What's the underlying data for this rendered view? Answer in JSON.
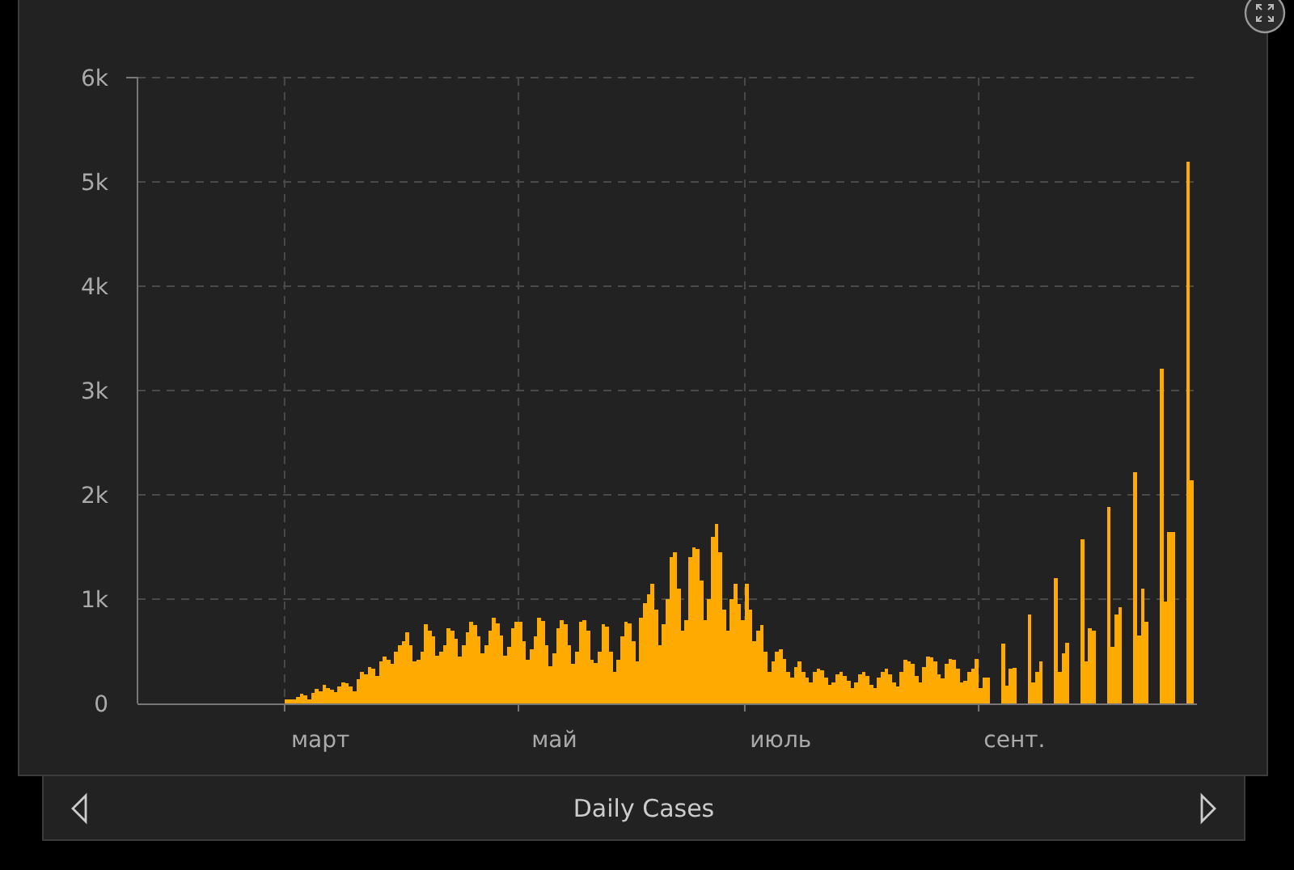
{
  "chart_data": {
    "type": "bar",
    "title": "Daily Cases",
    "ylim": [
      0,
      6000
    ],
    "yticks": [
      {
        "value": 0,
        "label": "0"
      },
      {
        "value": 1000,
        "label": "1k"
      },
      {
        "value": 2000,
        "label": "2k"
      },
      {
        "value": 3000,
        "label": "3k"
      },
      {
        "value": 4000,
        "label": "4k"
      },
      {
        "value": 5000,
        "label": "5k"
      },
      {
        "value": 6000,
        "label": "6k"
      }
    ],
    "grid": true,
    "categories": [
      null,
      null,
      null,
      null,
      null,
      null,
      null,
      null,
      null,
      null,
      null,
      null,
      null,
      null,
      null,
      null,
      null,
      null,
      null,
      null,
      null,
      null,
      null,
      null,
      null,
      null,
      null,
      null,
      null,
      null,
      null,
      null,
      null,
      null,
      null,
      null,
      null,
      null,
      null,
      null,
      null,
      null,
      null,
      null,
      null,
      null,
      null,
      null,
      "март",
      null,
      null,
      null,
      null,
      null,
      null,
      null,
      null,
      null,
      null,
      null,
      null,
      null,
      null,
      null,
      null,
      null,
      null,
      null,
      null,
      null,
      null,
      null,
      null,
      null,
      null,
      null,
      null,
      null,
      null,
      null,
      null,
      null,
      null,
      null,
      null,
      null,
      null,
      null,
      null,
      null,
      null,
      null,
      null,
      null,
      null,
      null,
      null,
      null,
      null,
      null,
      null,
      null,
      null,
      null,
      null,
      null,
      null,
      null,
      null,
      null,
      "май",
      null,
      null,
      null,
      null,
      null,
      null,
      null,
      null,
      null,
      null,
      null,
      null,
      null,
      null,
      null,
      null,
      null,
      null,
      null,
      null,
      null,
      null,
      null,
      null,
      null,
      null,
      null,
      null,
      null,
      null,
      null,
      null,
      null,
      null,
      null,
      null,
      null,
      null,
      null,
      null,
      null,
      null,
      null,
      null,
      null,
      null,
      null,
      null,
      null,
      null,
      null,
      null,
      null,
      null,
      null,
      null,
      null,
      null,
      null,
      "июль",
      null,
      null,
      null,
      null,
      null,
      null,
      null,
      null,
      null,
      null,
      null,
      null,
      null,
      null,
      null,
      null,
      null,
      null,
      null,
      null,
      null,
      null,
      null,
      null,
      null,
      null,
      null,
      null,
      null,
      null,
      null,
      null,
      null,
      null,
      null,
      null,
      null,
      null,
      null,
      null,
      null,
      null,
      null,
      null,
      null,
      null,
      null,
      null,
      null,
      null,
      null,
      null,
      null,
      null,
      null,
      null,
      null,
      null,
      null,
      null,
      null,
      "сент.",
      null,
      null,
      null,
      null,
      null,
      null,
      null,
      null,
      null,
      null,
      null,
      null,
      null,
      null,
      null,
      null,
      null,
      null,
      null,
      null,
      null,
      null,
      null,
      null,
      null,
      null,
      null,
      null,
      null,
      null,
      null,
      null,
      null,
      null,
      null,
      null,
      null,
      null,
      null,
      null,
      null,
      null,
      null,
      null,
      null,
      null,
      null
    ],
    "series": [
      {
        "color": "#ffaa00",
        "values": [
          0,
          0,
          0,
          0,
          0,
          0,
          0,
          0,
          0,
          0,
          0,
          0,
          0,
          0,
          0,
          0,
          0,
          0,
          0,
          0,
          0,
          0,
          0,
          0,
          0,
          0,
          0,
          0,
          0,
          0,
          0,
          0,
          0,
          0,
          0,
          0,
          0,
          0,
          0,
          40,
          40,
          40,
          60,
          90,
          80,
          40,
          100,
          140,
          120,
          180,
          150,
          130,
          110,
          160,
          200,
          190,
          160,
          120,
          230,
          300,
          280,
          350,
          330,
          260,
          400,
          450,
          420,
          380,
          500,
          560,
          600,
          680,
          560,
          400,
          420,
          500,
          760,
          700,
          640,
          460,
          500,
          560,
          720,
          700,
          620,
          450,
          560,
          680,
          780,
          750,
          640,
          480,
          560,
          700,
          820,
          770,
          650,
          460,
          540,
          720,
          780,
          780,
          600,
          420,
          520,
          640,
          820,
          790,
          560,
          360,
          480,
          720,
          800,
          760,
          560,
          380,
          500,
          780,
          800,
          700,
          420,
          390,
          500,
          760,
          740,
          500,
          300,
          420,
          640,
          780,
          770,
          600,
          400,
          820,
          960,
          1050,
          1150,
          900,
          560,
          760,
          1000,
          1400,
          1450,
          1100,
          700,
          800,
          1400,
          1500,
          1480,
          1180,
          800,
          1000,
          1600,
          1720,
          1450,
          900,
          700,
          1000,
          1150,
          950,
          800,
          1150,
          900,
          600,
          700,
          750,
          500,
          300,
          400,
          500,
          520,
          430,
          300,
          250,
          350,
          400,
          300,
          250,
          200,
          300,
          330,
          320,
          250,
          180,
          200,
          280,
          300,
          260,
          220,
          150,
          200,
          280,
          300,
          260,
          180,
          150,
          250,
          300,
          330,
          280,
          200,
          160,
          300,
          420,
          400,
          380,
          260,
          200,
          350,
          450,
          440,
          400,
          280,
          240,
          380,
          430,
          420,
          330,
          200,
          220,
          300,
          330,
          430,
          150,
          250,
          250,
          0,
          0,
          0,
          570,
          170,
          330,
          340,
          0,
          0,
          0,
          850,
          200,
          300,
          400,
          0,
          0,
          0,
          1200,
          300,
          480,
          580,
          0,
          0,
          0,
          1570,
          400,
          720,
          700,
          0,
          0,
          0,
          1880,
          540,
          850,
          920,
          0,
          0,
          0,
          2220,
          650,
          1100,
          780,
          0,
          0,
          0,
          3210,
          980,
          1640,
          1640,
          0,
          0,
          0,
          5190,
          2140
        ]
      }
    ]
  }
}
